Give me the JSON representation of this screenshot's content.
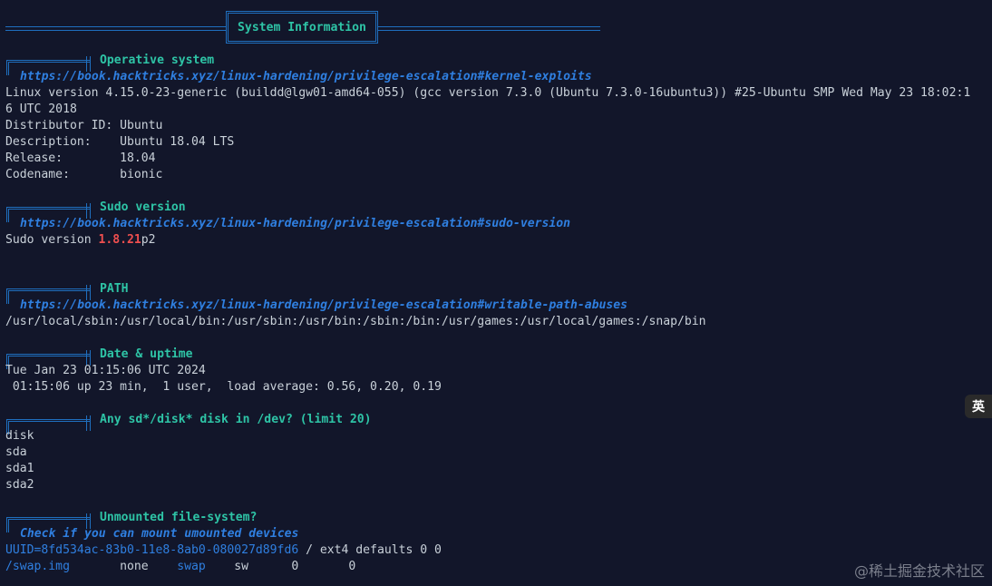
{
  "header": {
    "title": "System Information"
  },
  "sections": [
    {
      "title": "Operative system",
      "link": "https://book.hacktricks.xyz/linux-hardening/privilege-escalation#kernel-exploits",
      "lines": [
        "Linux version 4.15.0-23-generic (buildd@lgw01-amd64-055) (gcc version 7.3.0 (Ubuntu 7.3.0-16ubuntu3)) #25-Ubuntu SMP Wed May 23 18:02:1",
        "6 UTC 2018",
        "Distributor ID: Ubuntu",
        "Description:    Ubuntu 18.04 LTS",
        "Release:        18.04",
        "Codename:       bionic"
      ]
    },
    {
      "title": "Sudo version",
      "link": "https://book.hacktricks.xyz/linux-hardening/privilege-escalation#sudo-version",
      "sudo": {
        "prefix": "Sudo version ",
        "highlight": "1.8.21",
        "suffix": "p2"
      }
    },
    {
      "title": "PATH",
      "link": "https://book.hacktricks.xyz/linux-hardening/privilege-escalation#writable-path-abuses",
      "lines": [
        "/usr/local/sbin:/usr/local/bin:/usr/sbin:/usr/bin:/sbin:/bin:/usr/games:/usr/local/games:/snap/bin"
      ]
    },
    {
      "title": "Date & uptime",
      "lines": [
        "Tue Jan 23 01:15:06 UTC 2024",
        " 01:15:06 up 23 min,  1 user,  load average: 0.56, 0.20, 0.19"
      ]
    },
    {
      "title": "Any sd*/disk* disk in /dev? (limit 20)",
      "lines": [
        "disk",
        "sda",
        "sda1",
        "sda2"
      ]
    },
    {
      "title": "Unmounted file-system?",
      "link": "Check if you can mount umounted devices",
      "fstab1": {
        "uuid": "UUID=8fd534ac-83b0-11e8-8ab0-080027d89fd6",
        "sep": " / ",
        "rest": "ext4 defaults 0 0"
      },
      "fstab2": {
        "path": "/swap.img",
        "gap1": "       none    ",
        "swap": "swap",
        "rest": "    sw      0       0"
      }
    }
  ],
  "overlay": {
    "ime_label": "英",
    "watermark": "@稀土掘金技术社区"
  },
  "colors": {
    "background": "#12162a",
    "text": "#c9d1d9",
    "title_green": "#2ec4a6",
    "link_blue": "#2f7fe0",
    "frame_blue": "#1f6fbf",
    "highlight_red": "#ef4f4f"
  }
}
